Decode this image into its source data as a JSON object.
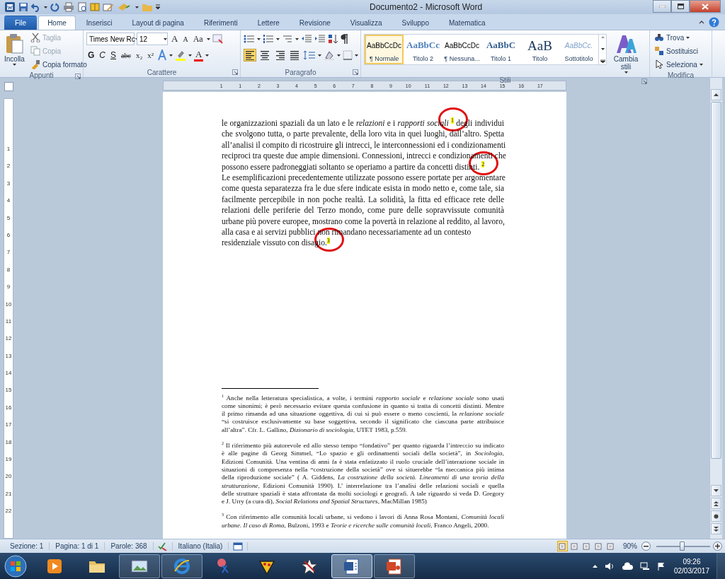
{
  "window": {
    "title": "Documento2 - Microsoft Word"
  },
  "tabs": [
    {
      "label": "File",
      "kind": "file",
      "selected": false
    },
    {
      "label": "Home",
      "kind": "tab",
      "selected": true
    },
    {
      "label": "Inserisci",
      "kind": "tab",
      "selected": false
    },
    {
      "label": "Layout di pagina",
      "kind": "tab",
      "selected": false
    },
    {
      "label": "Riferimenti",
      "kind": "tab",
      "selected": false
    },
    {
      "label": "Lettere",
      "kind": "tab",
      "selected": false
    },
    {
      "label": "Revisione",
      "kind": "tab",
      "selected": false
    },
    {
      "label": "Visualizza",
      "kind": "tab",
      "selected": false
    },
    {
      "label": "Sviluppo",
      "kind": "tab",
      "selected": false
    },
    {
      "label": "Matematica",
      "kind": "tab",
      "selected": false
    }
  ],
  "ribbon": {
    "clipboard": {
      "label": "Appunti",
      "paste": "Incolla",
      "items": [
        {
          "label": "Taglia",
          "kind": "cut",
          "disabled": true
        },
        {
          "label": "Copia",
          "kind": "copy",
          "disabled": true
        },
        {
          "label": "Copia formato",
          "kind": "brush",
          "disabled": false
        }
      ]
    },
    "font": {
      "label": "Carattere",
      "font_name": "Times New Rc",
      "font_size": "12",
      "grow": "A",
      "shrink": "A",
      "case": "Aa",
      "format": [
        {
          "label": "G",
          "kind": "bold"
        },
        {
          "label": "C",
          "kind": "italic"
        },
        {
          "label": "S",
          "kind": "underline"
        },
        {
          "label": "abc",
          "kind": "strike"
        },
        {
          "label": "x₂",
          "kind": "sub"
        },
        {
          "label": "x²",
          "kind": "sup"
        }
      ],
      "color_label": "A"
    },
    "paragraph": {
      "label": "Paragrafo",
      "alignment": [
        {
          "kind": "left",
          "selected": true
        },
        {
          "kind": "center",
          "selected": false
        },
        {
          "kind": "right",
          "selected": false
        },
        {
          "kind": "justify",
          "selected": false
        }
      ]
    },
    "styles": {
      "label": "Stili",
      "items": [
        {
          "sample": "AaBbCcDc",
          "name": "¶ Normale",
          "kind": "normal",
          "selected": true
        },
        {
          "sample": "AaBbCc",
          "name": "Titolo 2",
          "kind": "heading2",
          "selected": false
        },
        {
          "sample": "AaBbCcDc",
          "name": "¶ Nessuna...",
          "kind": "normal",
          "selected": false
        },
        {
          "sample": "AaBbC",
          "name": "Titolo 1",
          "kind": "heading1",
          "selected": false
        },
        {
          "sample": "AaB",
          "name": "Titolo",
          "kind": "title",
          "selected": false
        },
        {
          "sample": "AaBbCc.",
          "name": "Sottotitolo",
          "kind": "subtitle",
          "selected": false
        }
      ],
      "change_styles": "Cambia stili"
    },
    "editing": {
      "label": "Modifica",
      "items": [
        {
          "label": "Trova",
          "kind": "find"
        },
        {
          "label": "Sostituisci",
          "kind": "replace"
        },
        {
          "label": "Seleziona",
          "kind": "select"
        }
      ]
    }
  },
  "ruler": {
    "numbers": [
      "1",
      "1",
      "2",
      "3",
      "4",
      "5",
      "6",
      "7",
      "8",
      "9",
      "10",
      "11",
      "12",
      "13",
      "14",
      "15",
      "16",
      "17"
    ]
  },
  "vertical_ruler": {
    "numbers": [
      "1",
      "2",
      "3",
      "4",
      "5",
      "6",
      "7",
      "8",
      "9",
      "10",
      "11",
      "12",
      "13",
      "14",
      "15",
      "16",
      "17",
      "18",
      "19",
      "20",
      "21",
      "22"
    ]
  },
  "document": {
    "paragraphs": [
      [
        "le organizzazioni spaziali da un lato e le *relazioni* e i *rapporti sociali* $^{1}$ degli individui",
        "che svolgono tutta, o parte prevalente, della loro vita in quei luoghi, dall’altro. Spetta",
        "all’analisi il compito di ricostruire gli intrecci, le interconnessioni ed i condizionamenti",
        "reciproci tra queste due ampie dimensioni. Connessioni, intrecci e condizionamenti che",
        "possono essere padroneggiati soltanto se operiamo a partire da concetti distinti. $^{2}$"
      ],
      [
        "Le esemplificazioni precedentemente utilizzate possono essere portate per argomentare",
        "come questa separatezza fra le due sfere indicate esista in modo netto e, come tale, sia",
        "facilmente percepibile in non poche realtà. La solidità, la fitta ed efficace rete delle",
        "relazioni delle periferie del Terzo mondo, come pure delle sopravvissute comunità",
        "urbane più povere europee, mostrano come la povertà in relazione al reddito, al lavoro,",
        "alla casa e ai servizi pubblici non rimandano necessariamente ad un contesto"
      ],
      [
        "residenziale vissuto con disagio.$^{3}$"
      ]
    ],
    "reference_marks": [
      {
        "highlighted": true,
        "circled": true
      },
      {
        "highlighted": true,
        "circled": true
      },
      {
        "highlighted": true,
        "circled": true
      }
    ],
    "footnotes": [
      [
        "$^{1}$ Anche nella letteratura specialistica, a volte, i termini *rapporto sociale* e *relazione sociale* sono usati",
        "come sinonimi; è però necessario evitare questa confusione in quanto si tratta di concetti distinti. Mentre",
        "il primo rimanda ad una situazione oggettiva, di cui si può essere o meno coscienti, la *relazione sociale*",
        "“si costruisce esclusivamente su base soggettiva, secondo il significato che ciascuna parte attribuisce",
        "all’altra”. Cfr. L. Gallino, *Dizionario di sociologia*, UTET 1983, p.559."
      ],
      [
        "$^{2}$ Il riferimento più autorevole ed allo stesso tempo “fondativo” per quanto riguarda l’intreccio su indicato",
        "è alle pagine di Georg Simmel, “Lo spazio e gli ordinamenti sociali della società”, in *Sociologia*,",
        "Edizioni Comunità. Una ventina di anni fa è stata enfatizzato il ruolo cruciale dell’interazione sociale in",
        "situazioni di compresenza nella “costruzione della società” ove si situerebbe “la meccanica più intima",
        "della riproduzione sociale” ( A. Giddens, *La costruzione della società. Lineamenti di una teoria della*",
        "*strutturazione*, Edizioni Comunità 1990). L’ interrelazione tra l’analisi delle relazioni sociali e quella",
        "delle strutture spaziali è stata affrontata da molti sociologi e geografi. A tale riguardo si veda D. Gregory",
        "e J. Urry (a cura di), *Social Relations and Spatial Structures*, MacMillan 1985)"
      ],
      [
        "$^{3}$ Con riferimento alle comunità locali urbane, si vedono i lavori di Anna Rosa Montani, *Comunità locali*",
        "*urbane. Il caso di Roma*, Bulzoni, 1993 e *Teorie e ricerche sulle comunità locali*, Franco Angeli, 2000."
      ]
    ]
  },
  "status_bar": {
    "items": [
      "Sezione: 1",
      "Pagina: 1 di 1",
      "Parole: 368",
      "Italiano (Italia)"
    ],
    "views": [
      {
        "selected": true
      },
      {
        "selected": false
      },
      {
        "selected": false
      },
      {
        "selected": false
      },
      {
        "selected": false
      }
    ],
    "zoom": "90%",
    "zoom_slider": {
      "level": 0.47
    }
  },
  "taskbar": {
    "apps": [
      {
        "kind": "media",
        "running": false,
        "selected": false
      },
      {
        "kind": "folder",
        "running": false,
        "selected": false
      },
      {
        "kind": "picture",
        "running": true,
        "selected": false
      },
      {
        "kind": "browser",
        "running": true,
        "selected": false
      },
      {
        "kind": "scissors",
        "running": false,
        "selected": false
      },
      {
        "kind": "pizza",
        "running": false,
        "selected": false
      },
      {
        "kind": "star",
        "running": false,
        "selected": false
      },
      {
        "kind": "doc",
        "running": true,
        "selected": true
      },
      {
        "kind": "slides",
        "running": true,
        "selected": false
      }
    ],
    "time": "09:26",
    "date": "02/03/2017"
  }
}
